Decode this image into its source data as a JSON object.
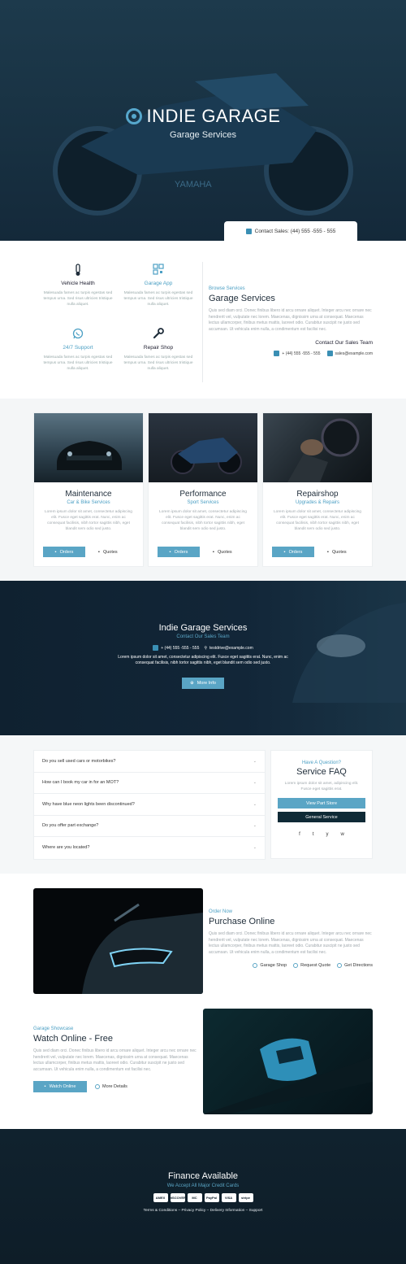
{
  "hero": {
    "title": "INDIE GARAGE",
    "subtitle": "Garage Services",
    "contact_sales": "Contact Sales: (44) 555 -555 - 555",
    "bike_brand": "YAMAHA"
  },
  "features": [
    {
      "title": "Vehicle Health",
      "icon": "thermometer-icon",
      "accent": false,
      "desc": "Malesuada fames ac turpis egestas sed tempus urna. Sed risus ultricies tristique nulla aliquet."
    },
    {
      "title": "Garage App",
      "icon": "qr-code-icon",
      "accent": true,
      "desc": "Malesuada fames ac turpis egestas sed tempus urna. Sed risus ultricies tristique nulla aliquet."
    },
    {
      "title": "24/7 Support",
      "icon": "whatsapp-icon",
      "accent": true,
      "desc": "Malesuada fames ac turpis egestas sed tempus urna. Sed risus ultricies tristique nulla aliquet."
    },
    {
      "title": "Repair Shop",
      "icon": "wrench-icon",
      "accent": false,
      "desc": "Malesuada fames ac turpis egestas sed tempus urna. Sed risus ultricies tristique nulla aliquet."
    }
  ],
  "browse": {
    "eyebrow": "Browse Services",
    "title": "Garage Services",
    "text": "Quis sed diam orci. Donec finibus libero id arcu ornare aliquet. Integer arcu nec ornare nec hendrerit vel, vulputate nec lorem. Maecenas, dignissim urna at consequat. Maecenas lectus ullamcorper, finibus metus mattis, laoreet odio. Curabitur suscipit ne justo sed accumsan. Ut vehicula enim nulla, a condimentum est facilisi nec.",
    "contact_title": "Contact Our Sales Team",
    "phone": "+ (44) 555 -555 - 555",
    "email": "sales@example.com"
  },
  "cards": [
    {
      "title": "Maintenance",
      "subtitle": "Car & Bike Services",
      "desc": "Lorem ipsum dolor sit amet, consectetur adipiscing elit. Fusce eget sagittis erat. Nunc, enim ac consequat facilisis, nibh tortor sagittis nibh, eget blandit sem odio sed justo.",
      "btn_primary": "Orders",
      "btn_secondary": "Quotes"
    },
    {
      "title": "Performance",
      "subtitle": "Sport Services",
      "desc": "Lorem ipsum dolor sit amet, consectetur adipiscing elit. Fusce eget sagittis erat. Nunc, enim ac consequat facilisis, nibh tortor sagittis nibh, eget blandit sem odio sed justo.",
      "btn_primary": "Orders",
      "btn_secondary": "Quotes"
    },
    {
      "title": "Repairshop",
      "subtitle": "Upgrades & Repairs",
      "desc": "Lorem ipsum dolor sit amet, consectetur adipiscing elit. Fusce eget sagittis erat. Nunc, enim ac consequat facilisis, nibh tortor sagittis nibh, eget blandit sem odio sed justo.",
      "btn_primary": "Orders",
      "btn_secondary": "Quotes"
    }
  ],
  "band": {
    "title": "Indie Garage Services",
    "subtitle": "Contact Our Sales Team",
    "phone": "+ (44) 555 -555 - 555",
    "email": "testdrive@example.com",
    "text1": "Lorem ipsum dolor sit amet, consectetur adipiscing elit. Fusce eget sagittis erat. Nunc, enim ac",
    "text2": "consequat facilisis, nibh tortor sagittis nibh, eget blandit sem odio sed justo.",
    "button": "More Info"
  },
  "faq": {
    "items": [
      "Do you sell used cars or motorbikes?",
      "How can I book my car in for an MOT?",
      "Why have blue neon lights been discontinued?",
      "Do you offer part exchange?",
      "Where are you located?"
    ],
    "box_eyebrow": "Have A Question?",
    "box_title": "Service FAQ",
    "box_text": "Lorem ipsum dolor sit amet, adipiscing elit. Fusce eget sagittis erat.",
    "btn1": "View Part Store",
    "btn2": "General Service",
    "social": [
      "f",
      "t",
      "y",
      "w"
    ]
  },
  "purchase": {
    "eyebrow": "Order Now",
    "title": "Purchase Online",
    "text": "Quis sed diam orci. Donec finibus libero id arcu ornare aliquet. Integer arcu nec ornare nec hendrerit vel, vulputate nec lorem. Maecenas, dignissim urna at consequat. Maecenas lectus ullamcorper, finibus metus mattis, laoreet odio. Curabitur suscipit ne justo sed accumsan. Ut vehicula enim nulla, a condimentum est facilisi nec.",
    "links": [
      "Garage Shop",
      "Request Quote",
      "Get Directions"
    ]
  },
  "watch": {
    "eyebrow": "Garage Showcase",
    "title": "Watch Online - Free",
    "text": "Quis sed diam orci. Donec finibus libero id arcu ornare aliquet. Integer arcu nec ornare nec hendrerit vel, vulputate nec lorem. Maecenas, dignissim urna at consequat. Maecenas lectus ullamcorper, finibus metus mattis, laoreet odio. Curabitur suscipit ne justo sed accumsan. Ut vehicula enim nulla, a condimentum est facilisi nec.",
    "button": "Watch Online",
    "more": "More Details"
  },
  "footer": {
    "title": "Finance Available",
    "subtitle": "We Accept All Major Credit Cards",
    "cards": [
      "AMEX",
      "DISCOVER",
      "MC",
      "PayPal",
      "VISA",
      "stripe"
    ],
    "links": "Terms & Conditions – Privacy Policy – Delivery Information – Support"
  },
  "colors": {
    "accent": "#5aa5c5",
    "dark": "#0f2130"
  }
}
